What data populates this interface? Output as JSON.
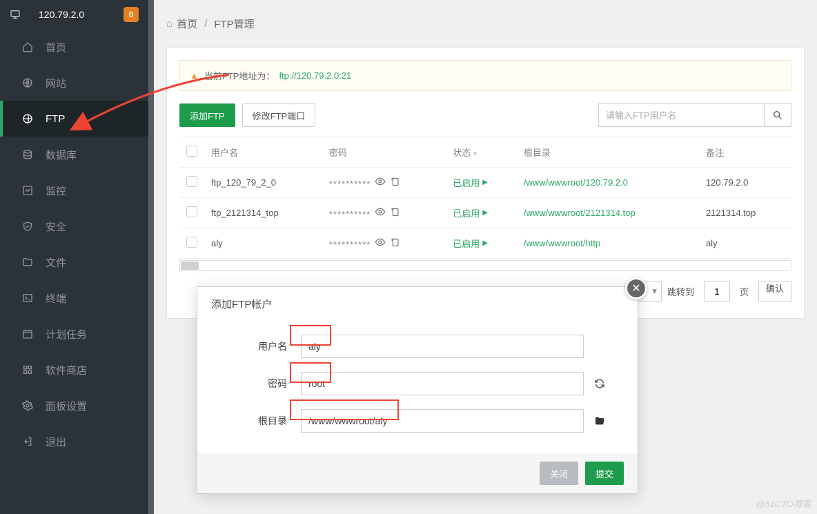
{
  "header": {
    "ip": "120.79.2.0",
    "badge": "0"
  },
  "sidebar": {
    "items": [
      {
        "label": "首页",
        "icon": "home-icon"
      },
      {
        "label": "网站",
        "icon": "globe-icon"
      },
      {
        "label": "FTP",
        "icon": "ftp-icon",
        "active": true
      },
      {
        "label": "数据库",
        "icon": "database-icon"
      },
      {
        "label": "监控",
        "icon": "monitor-icon"
      },
      {
        "label": "安全",
        "icon": "shield-icon"
      },
      {
        "label": "文件",
        "icon": "folder-icon"
      },
      {
        "label": "终端",
        "icon": "terminal-icon"
      },
      {
        "label": "计划任务",
        "icon": "calendar-icon"
      },
      {
        "label": "软件商店",
        "icon": "apps-icon"
      },
      {
        "label": "面板设置",
        "icon": "gear-icon"
      },
      {
        "label": "退出",
        "icon": "logout-icon"
      }
    ]
  },
  "breadcrumb": {
    "home": "首页",
    "current": "FTP管理"
  },
  "alert": {
    "prefix": "当前FTP地址为：",
    "link": "ftp://120.79.2.0:21"
  },
  "toolbar": {
    "add": "添加FTP",
    "port": "修改FTP端口",
    "search_placeholder": "请输入FTP用户名"
  },
  "table": {
    "cols": {
      "user": "用户名",
      "pw": "密码",
      "status": "状态",
      "root": "根目录",
      "remark": "备注"
    },
    "rows": [
      {
        "user": "ftp_120_79_2_0",
        "pw": "**********",
        "status": "已启用",
        "root": "/www/wwwroot/120.79.2.0",
        "remark": "120.79.2.0"
      },
      {
        "user": "ftp_2121314_top",
        "pw": "**********",
        "status": "已启用",
        "root": "/www/wwwroot/2121314.top",
        "remark": "2121314.top"
      },
      {
        "user": "aly",
        "pw": "**********",
        "status": "已启用",
        "root": "/www/wwwroot/http",
        "remark": "aly"
      }
    ]
  },
  "pager": {
    "jump_label": "跳转到",
    "page_input": "1",
    "page_unit": "页",
    "confirm": "确认"
  },
  "modal": {
    "title": "添加FTP帐户",
    "fields": {
      "user_label": "用户名",
      "user_value": "aly",
      "pw_label": "密码",
      "pw_value": "root",
      "root_label": "根目录",
      "root_value": "/www/wwwroot/aly"
    },
    "close": "关闭",
    "submit": "提交"
  },
  "watermark": "@51CTO博客"
}
